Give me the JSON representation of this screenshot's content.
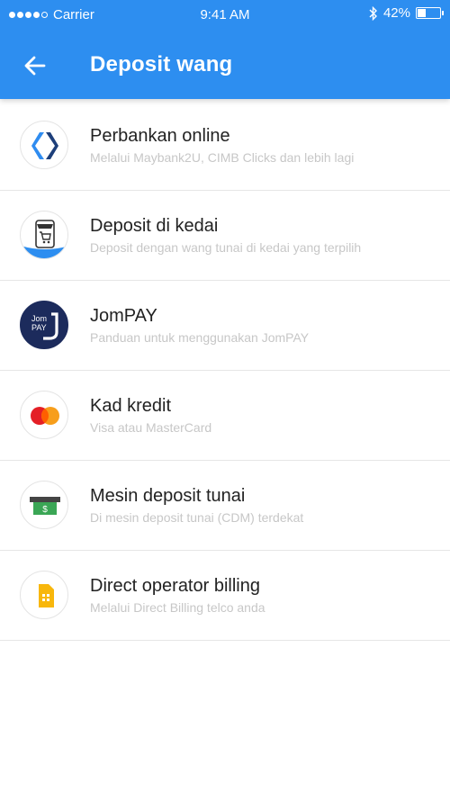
{
  "status_bar": {
    "carrier": "Carrier",
    "time": "9:41 AM",
    "battery": "42%",
    "battery_level": 0.42
  },
  "header": {
    "title": "Deposit wang"
  },
  "items": [
    {
      "title": "Perbankan online",
      "subtitle": "Melalui Maybank2U, CIMB Clicks dan lebih lagi",
      "icon": "online-banking-icon"
    },
    {
      "title": "Deposit di kedai",
      "subtitle": "Deposit dengan wang tunai di kedai yang terpilih",
      "icon": "store-icon"
    },
    {
      "title": "JomPAY",
      "subtitle": "Panduan untuk menggunakan JomPAY",
      "icon": "jompay-logo",
      "logo_text": [
        "Jom",
        "PAY"
      ]
    },
    {
      "title": "Kad kredit",
      "subtitle": "Visa atau MasterCard",
      "icon": "credit-card-icon"
    },
    {
      "title": "Mesin deposit tunai",
      "subtitle": "Di mesin deposit tunai (CDM) terdekat",
      "icon": "cash-machine-icon"
    },
    {
      "title": "Direct operator billing",
      "subtitle": "Melalui Direct Billing telco anda",
      "icon": "sim-card-icon"
    }
  ],
  "colors": {
    "header": "#2d8ef0",
    "title_text": "#222222",
    "subtitle_text": "#c7c7c7"
  }
}
